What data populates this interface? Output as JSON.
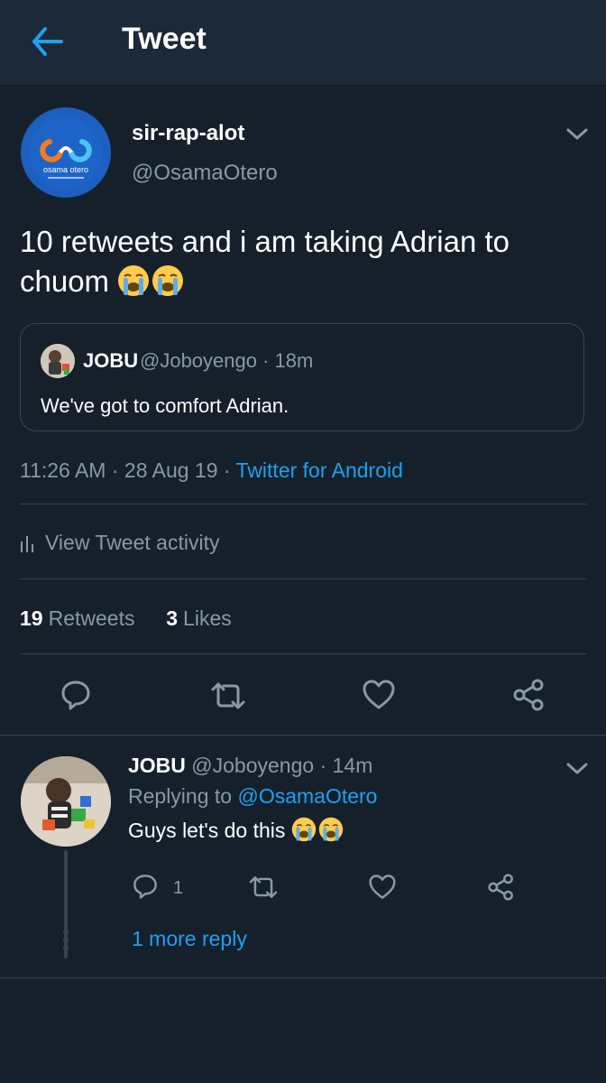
{
  "header": {
    "title": "Tweet"
  },
  "tweet": {
    "author_name": "sir-rap-alot",
    "author_handle": "@OsamaOtero",
    "text_line1": "10 retweets and i am taking Adrian to",
    "text_line2": "chuom",
    "emojis": [
      "loudly-crying-face",
      "loudly-crying-face"
    ],
    "quote": {
      "name": "JOBU",
      "handle": "@Joboyengo · 18m",
      "text": "We've got to comfort Adrian."
    },
    "timestamp": "11:26 AM · 28 Aug 19 · ",
    "source": "Twitter for Android",
    "activity_label": "View Tweet activity",
    "retweets_count": "19",
    "retweets_label": "Retweets",
    "likes_count": "3",
    "likes_label": "Likes"
  },
  "reply": {
    "name": "JOBU",
    "handle": "@Joboyengo · 14m",
    "replying_to_label": "Replying to ",
    "replying_to_handle": "@OsamaOtero",
    "text": "Guys let's do this",
    "reply_count": "1",
    "more_replies": "1 more reply"
  },
  "avatar_logo_text": "osama otero",
  "colors": {
    "background": "#15202b",
    "header": "#1c2938",
    "accent": "#1da1f2",
    "secondary_text": "#8899a6",
    "divider": "#38444d"
  }
}
